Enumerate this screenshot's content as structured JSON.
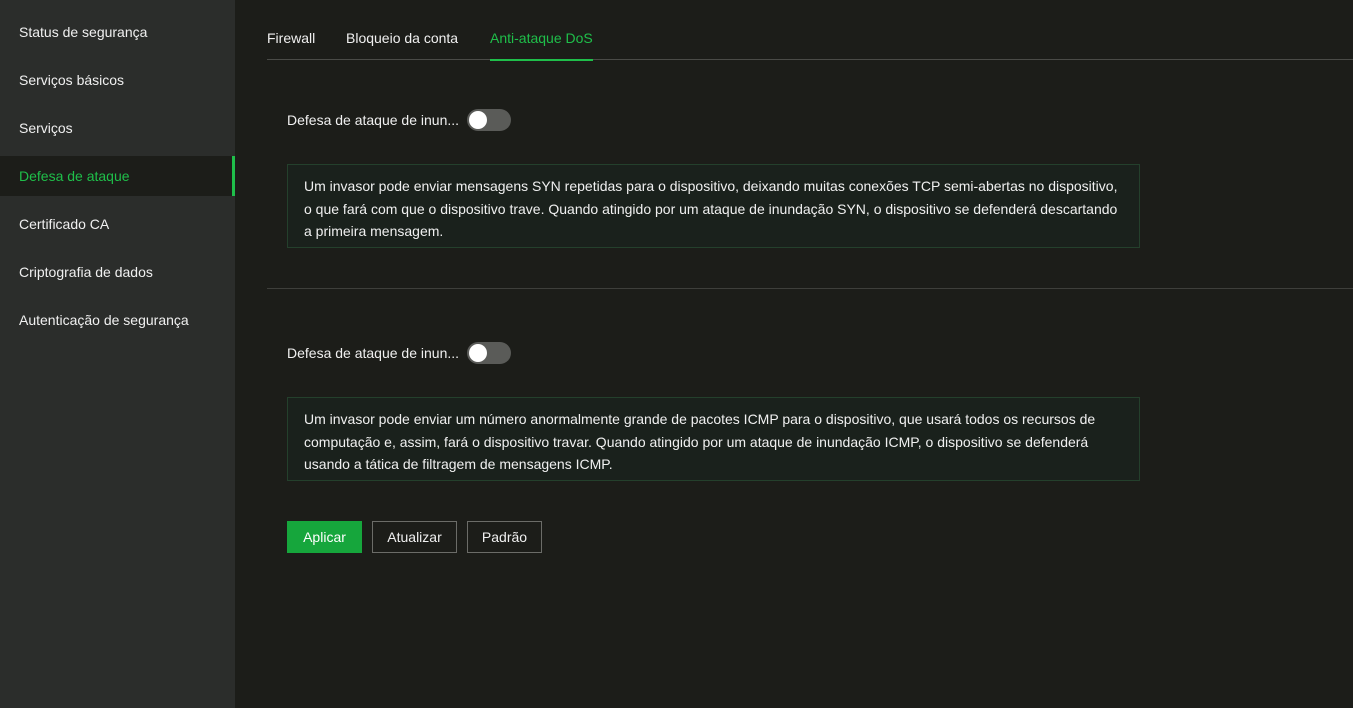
{
  "sidebar": {
    "items": [
      {
        "label": "Status de segurança"
      },
      {
        "label": "Serviços básicos"
      },
      {
        "label": "Serviços"
      },
      {
        "label": "Defesa de ataque"
      },
      {
        "label": "Certificado CA"
      },
      {
        "label": "Criptografia de dados"
      },
      {
        "label": "Autenticação de segurança"
      }
    ],
    "active_index": 3
  },
  "tabs": [
    {
      "label": "Firewall"
    },
    {
      "label": "Bloqueio da conta"
    },
    {
      "label": "Anti-ataque DoS"
    }
  ],
  "active_tab": 2,
  "sections": [
    {
      "label": "Defesa de ataque de inun...",
      "enabled": false,
      "description": "Um invasor pode enviar mensagens SYN repetidas para o dispositivo, deixando muitas conexões TCP semi-abertas no dispositivo, o que fará com que o dispositivo trave. Quando atingido por um ataque de inundação SYN, o dispositivo se defenderá descartando a primeira mensagem."
    },
    {
      "label": "Defesa de ataque de inun...",
      "enabled": false,
      "description": "Um invasor pode enviar um número anormalmente grande de pacotes ICMP para o dispositivo, que usará todos os recursos de computação e, assim, fará o dispositivo travar. Quando atingido por um ataque de inundação ICMP, o dispositivo se defenderá usando a tática de filtragem de mensagens ICMP."
    }
  ],
  "buttons": {
    "apply": "Aplicar",
    "refresh": "Atualizar",
    "default": "Padrão"
  },
  "colors": {
    "accent": "#1fbf4a",
    "primary_button": "#16a63c",
    "sidebar_bg": "#2b2d2b",
    "main_bg": "#1c1d19"
  }
}
